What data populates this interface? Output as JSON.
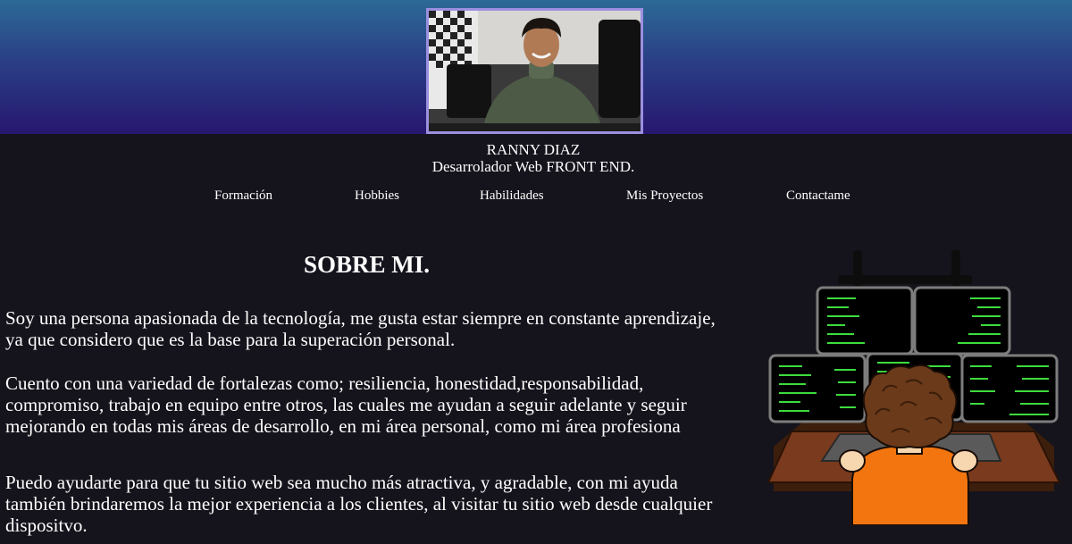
{
  "header": {
    "name": "RANNY DIAZ",
    "role": "Desarrolador Web FRONT END."
  },
  "nav": {
    "items": [
      {
        "label": "Formación"
      },
      {
        "label": "Hobbies"
      },
      {
        "label": "Habilidades"
      },
      {
        "label": "Mis Proyectos"
      },
      {
        "label": "Contactame"
      }
    ]
  },
  "about": {
    "title": "SOBRE MI.",
    "paragraphs": [
      "Soy una persona apasionada de la tecnología, me gusta estar siempre en constante aprendizaje, ya que considero que es la base para la superación personal.",
      "Cuento con una variedad de fortalezas como; resiliencia, honestidad,responsabilidad, compromiso, trabajo en equipo entre otros, las cuales me ayudan a seguir adelante y seguir mejorando en todas mis áreas de desarrollo, en mi área personal, como mi área profesiona",
      "Puedo ayudarte para que tu sitio web sea mucho más atractiva, y agradable, con mi ayuda también brindaremos la mejor experiencia a los clientes, al visitar tu sitio web desde cualquier dispositvo."
    ]
  },
  "colors": {
    "page_background": "#15141c",
    "header_gradient_top": "#2d6a96",
    "header_gradient_bottom": "#27176f",
    "photo_border": "#9b8fe0",
    "code_green": "#3ddc3d",
    "shirt_orange": "#f2750f"
  }
}
